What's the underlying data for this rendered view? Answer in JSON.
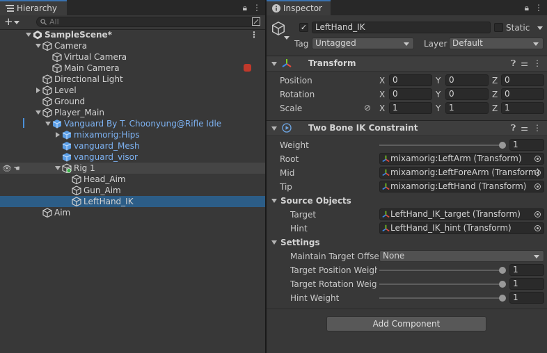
{
  "hierarchy": {
    "tab_label": "Hierarchy",
    "search_placeholder": "All",
    "lock_icon": "lock-icon",
    "menu_icon": "kebab-menu-icon",
    "rows": [
      {
        "label": "SampleScene*",
        "depth": 0,
        "arrow": "down",
        "icon": "unity-scene-icon",
        "bold": true
      },
      {
        "label": "Camera",
        "depth": 1,
        "arrow": "down",
        "icon": "gameobject-cube-icon"
      },
      {
        "label": "Virtual Camera",
        "depth": 2,
        "arrow": "",
        "icon": "gameobject-cube-icon"
      },
      {
        "label": "Main Camera",
        "depth": 2,
        "arrow": "",
        "icon": "gameobject-cube-icon",
        "badge": "red-badge-icon"
      },
      {
        "label": "Directional Light",
        "depth": 1,
        "arrow": "",
        "icon": "gameobject-cube-icon"
      },
      {
        "label": "Level",
        "depth": 1,
        "arrow": "right",
        "icon": "gameobject-cube-icon"
      },
      {
        "label": "Ground",
        "depth": 1,
        "arrow": "",
        "icon": "gameobject-cube-icon"
      },
      {
        "label": "Player_Main",
        "depth": 1,
        "arrow": "down",
        "icon": "gameobject-cube-icon"
      },
      {
        "label": "Vanguard By T. Choonyung@Rifle Idle",
        "depth": 2,
        "arrow": "down",
        "icon": "prefab-cube-icon",
        "blue": true
      },
      {
        "label": "mixamorig:Hips",
        "depth": 3,
        "arrow": "right",
        "icon": "prefab-cube-icon",
        "blue": true
      },
      {
        "label": "vanguard_Mesh",
        "depth": 3,
        "arrow": "",
        "icon": "prefab-cube-icon",
        "blue": true
      },
      {
        "label": "vanguard_visor",
        "depth": 3,
        "arrow": "",
        "icon": "prefab-cube-icon",
        "blue": true
      },
      {
        "label": "Rig 1",
        "depth": 3,
        "arrow": "down",
        "icon": "rig-cube-icon",
        "hl": true
      },
      {
        "label": "Head_Aim",
        "depth": 4,
        "arrow": "",
        "icon": "gameobject-cube-icon"
      },
      {
        "label": "Gun_Aim",
        "depth": 4,
        "arrow": "",
        "icon": "gameobject-cube-icon"
      },
      {
        "label": "LeftHand_IK",
        "depth": 4,
        "arrow": "",
        "icon": "gameobject-cube-icon",
        "selected": true
      },
      {
        "label": "Aim",
        "depth": 1,
        "arrow": "",
        "icon": "gameobject-cube-icon"
      }
    ]
  },
  "inspector": {
    "tab_label": "Inspector",
    "object_name": "LeftHand_IK",
    "active": true,
    "static_label": "Static",
    "tag_label": "Tag",
    "tag_value": "Untagged",
    "layer_label": "Layer",
    "layer_value": "Default",
    "transform": {
      "title": "Transform",
      "position_label": "Position",
      "rotation_label": "Rotation",
      "scale_label": "Scale",
      "position": {
        "x": "0",
        "y": "0",
        "z": "0"
      },
      "rotation": {
        "x": "0",
        "y": "0",
        "z": "0"
      },
      "scale": {
        "x": "1",
        "y": "1",
        "z": "1"
      }
    },
    "tbik": {
      "title": "Two Bone IK Constraint",
      "weight_label": "Weight",
      "weight_value": "1",
      "root_label": "Root",
      "root_value": "mixamorig:LeftArm (Transform)",
      "mid_label": "Mid",
      "mid_value": "mixamorig:LeftForeArm (Transform)",
      "tip_label": "Tip",
      "tip_value": "mixamorig:LeftHand (Transform)",
      "source_objects_label": "Source Objects",
      "target_label": "Target",
      "target_value": "LeftHand_IK_target (Transform)",
      "hint_label": "Hint",
      "hint_value": "LeftHand_IK_hint (Transform)",
      "settings_label": "Settings",
      "maintain_offset_label": "Maintain Target Offset",
      "maintain_offset_value": "None",
      "target_pos_weight_label": "Target Position Weight",
      "target_pos_weight_value": "1",
      "target_rot_weight_label": "Target Rotation Weigh",
      "target_rot_weight_value": "1",
      "hint_weight_label": "Hint Weight",
      "hint_weight_value": "1"
    },
    "add_component_label": "Add Component"
  },
  "colors": {
    "panel": "#383838",
    "selection": "#2c5d87",
    "prefab_blue": "#7db2f2"
  }
}
